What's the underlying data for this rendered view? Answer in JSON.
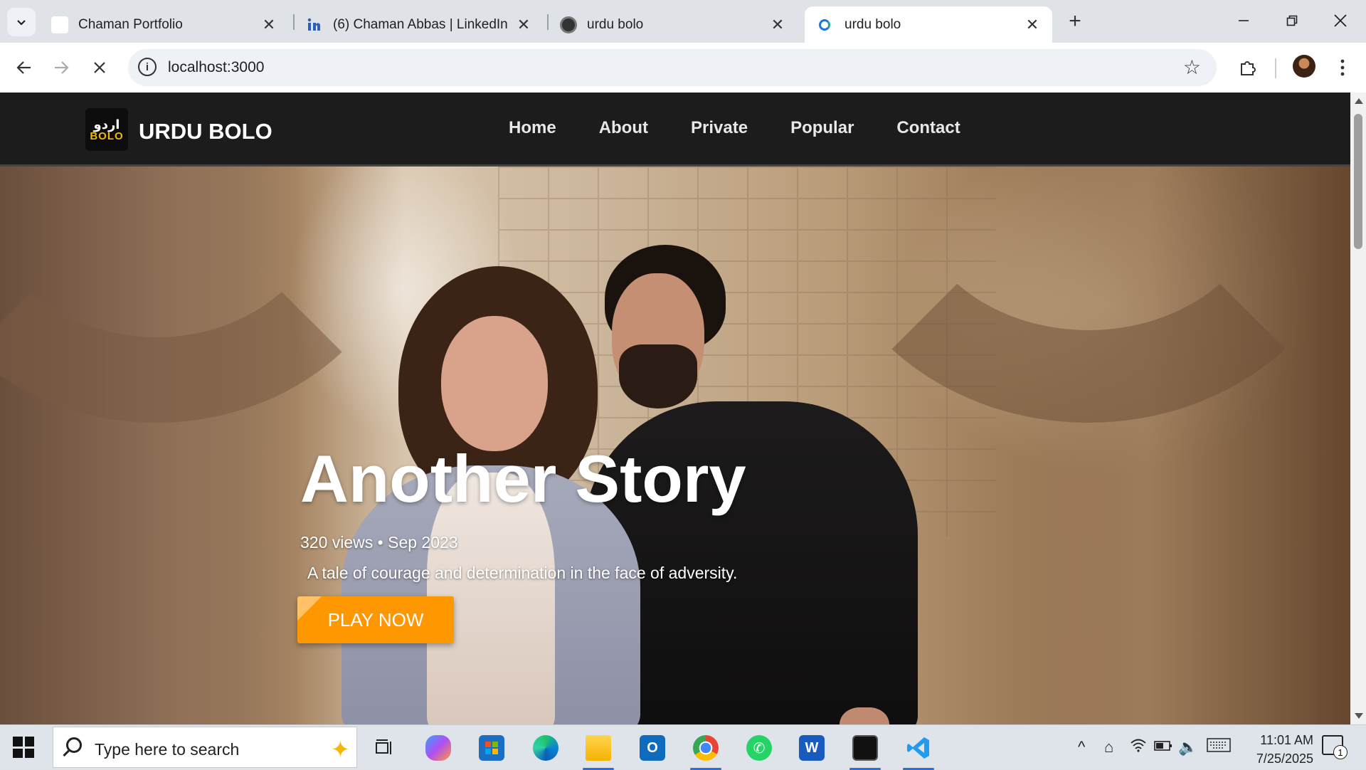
{
  "browser": {
    "tabs": [
      {
        "title": "Chaman Portfolio",
        "favicon": "blank-page-icon",
        "active": false
      },
      {
        "title": "(6) Chaman Abbas | LinkedIn",
        "favicon": "linkedin-icon",
        "active": false
      },
      {
        "title": "urdu bolo",
        "favicon": "urdu-bolo-icon",
        "active": false
      },
      {
        "title": "urdu bolo",
        "favicon": "loading-icon",
        "active": true
      }
    ],
    "url": "localhost:3000"
  },
  "site": {
    "logo_line1": "اردو",
    "logo_line2": "BOLO",
    "brand": "URDU BOLO",
    "nav": [
      "Home",
      "About",
      "Private",
      "Popular",
      "Contact"
    ]
  },
  "hero": {
    "title": "Another Story",
    "meta": "320 views • Sep 2023",
    "description": "A tale of courage and determination in the face of adversity.",
    "button": "PLAY NOW",
    "accent": "#ff9800"
  },
  "taskbar": {
    "search_placeholder": "Type here to search",
    "time": "11:01 AM",
    "date": "7/25/2025",
    "notification_count": "1"
  }
}
